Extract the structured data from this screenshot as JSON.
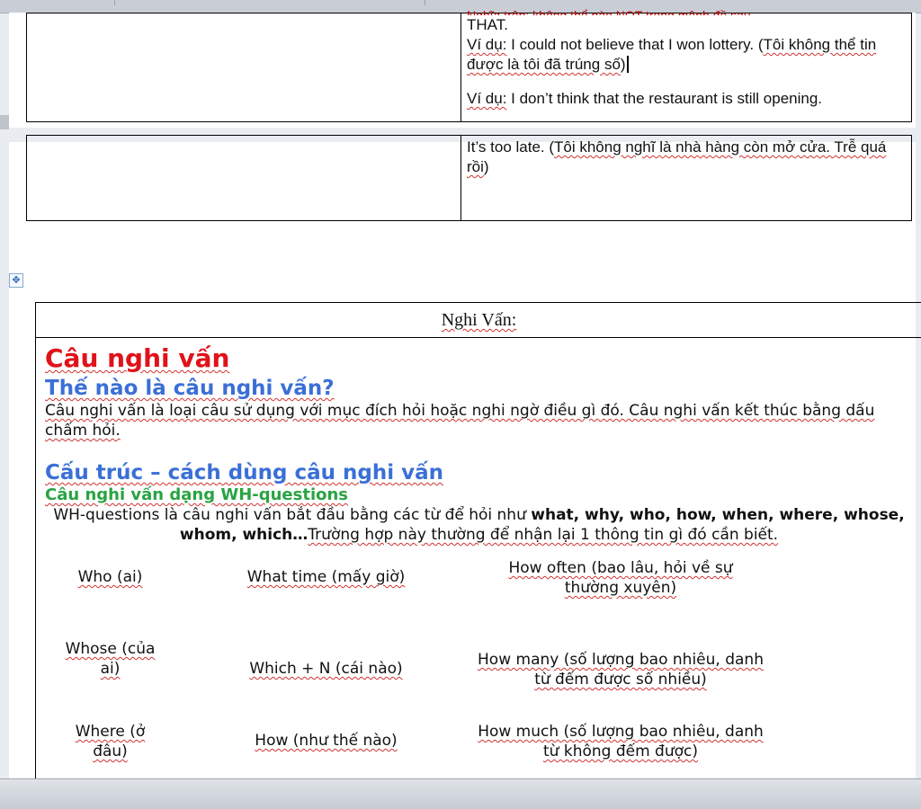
{
  "top_table": {
    "cut_line": "Nghĩa trên: không thể nào NOT trong mệnh đề sau",
    "line_that": "THAT.",
    "ex1_label": "Ví dụ:",
    "ex1_text": " I could not believe that I won lottery. (",
    "ex1_vn": "Tôi không thể tin được là tôi đã trúng số",
    "ex1_end": ")",
    "ex2_label": "Ví dụ:",
    "ex2_text": " I don’t think that the restaurant is still opening."
  },
  "second_table": {
    "text_a": "It’s too late. (",
    "text_vn": "Tôi không nghĩ là nhà hàng còn mở cửa. Trễ quá rồi",
    "text_end": ")"
  },
  "main": {
    "header": "Nghi Vấn:",
    "title": "Câu nghi vấn",
    "q_heading": "Thế nào là câu nghi vấn?",
    "definition": "Câu nghi vấn là loại câu sử dụng với mục đích hỏi hoặc nghi ngờ điều gì đó. Câu nghi vấn kết thúc bằng dấu chấm hỏi.",
    "structure_heading": "Cấu trúc – cách dùng câu nghi vấn",
    "wh_heading": "Câu nghi vấn dạng WH-questions",
    "wh_intro_a": "WH-questions là câu nghi vấn bắt đầu bằng các từ để hỏi như ",
    "wh_words": "what, why, who, how, when, where, whose, whom, which…",
    "wh_intro_b": "Trường hợp này thường để nhận lại 1 thông tin gì đó cần biết.",
    "grid": [
      [
        "Who (ai)",
        "What time (mấy giờ)",
        "How often (bao lâu, hỏi về sự thường xuyên)"
      ],
      [
        "Whose (của ai)",
        "Which + N (cái nào)",
        "How many (số lượng bao nhiêu, danh từ đếm được số nhiều)"
      ],
      [
        "Where (ở đâu)",
        "How (như thế nào)",
        "How much (số lượng bao nhiêu, danh từ không đếm được)"
      ]
    ]
  },
  "icons": {
    "move": "table-move-icon"
  }
}
